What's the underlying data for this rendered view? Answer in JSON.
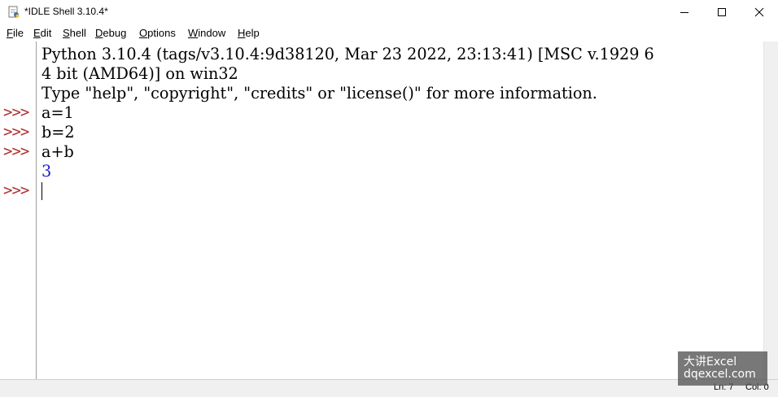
{
  "window": {
    "title": "*IDLE Shell 3.10.4*",
    "controls": {
      "minimize": "minimize-icon",
      "maximize": "maximize-icon",
      "close": "close-icon"
    }
  },
  "menu": {
    "items": [
      {
        "first": "F",
        "rest": "ile"
      },
      {
        "first": "E",
        "rest": "dit"
      },
      {
        "first": "S",
        "rest": "hell"
      },
      {
        "first": "D",
        "rest": "ebug"
      },
      {
        "first": "O",
        "rest": "ptions"
      },
      {
        "first": "W",
        "rest": "indow"
      },
      {
        "first": "H",
        "rest": "elp"
      }
    ]
  },
  "shell": {
    "prompt_symbol": ">>>",
    "lines": [
      {
        "text": "Python 3.10.4 (tags/v3.10.4:9d38120, Mar 23 2022, 23:13:41) [MSC v.1929 6",
        "kind": "banner"
      },
      {
        "text": "4 bit (AMD64)] on win32",
        "kind": "banner"
      },
      {
        "text": "Type \"help\", \"copyright\", \"credits\" or \"license()\" for more information.",
        "kind": "banner"
      },
      {
        "text": "a=1",
        "kind": "input"
      },
      {
        "text": "b=2",
        "kind": "input"
      },
      {
        "text": "a+b",
        "kind": "input"
      },
      {
        "text": "3",
        "kind": "output"
      },
      {
        "text": "",
        "kind": "input"
      }
    ]
  },
  "status": {
    "line": "Ln: 7",
    "col": "Col: 0"
  },
  "watermark": {
    "line1": "大讲Excel",
    "line2": "dqexcel.com"
  },
  "colors": {
    "prompt": "#b03030",
    "output": "#1a1ad0",
    "text": "#000000"
  }
}
